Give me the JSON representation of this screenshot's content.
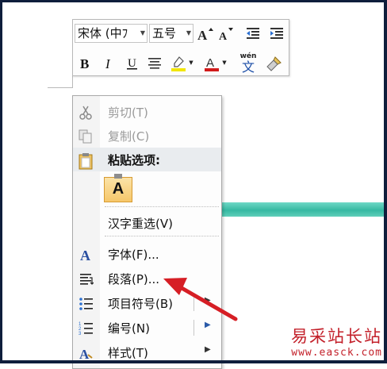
{
  "mini_toolbar": {
    "font_name": "宋体 (中ﾌ",
    "font_size": "五号",
    "wen_label": "wén",
    "wen_char": "文",
    "highlight_color": "#f2e600",
    "font_color": "#d21a1a"
  },
  "context_menu": {
    "items": [
      {
        "label": "剪切(T)",
        "icon": "scissors-icon"
      },
      {
        "label": "复制(C)",
        "icon": "copy-icon"
      },
      {
        "label": "粘贴选项:",
        "icon": "clipboard-icon"
      },
      {
        "label": "汉字重选(V)"
      },
      {
        "label": "字体(F)...",
        "icon": "font-icon"
      },
      {
        "label": "段落(P)...",
        "icon": "paragraph-icon"
      },
      {
        "label": "项目符号(B)",
        "icon": "bullets-icon"
      },
      {
        "label": "编号(N)",
        "icon": "numbering-icon"
      },
      {
        "label": "样式(T)",
        "icon": "styles-icon"
      }
    ],
    "paste_keep_text_glyph": "A"
  },
  "watermark": {
    "title": "易采站长站",
    "url": "www.easck.com"
  },
  "colors": {
    "arrow": "#d61e25",
    "teal_band": "#3fbfa8",
    "frame": "#0f1e3c"
  }
}
